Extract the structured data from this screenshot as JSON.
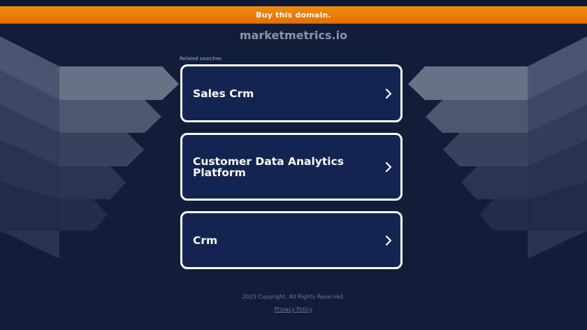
{
  "banner": {
    "text": "Buy this domain."
  },
  "domain": {
    "name": "marketmetrics.io"
  },
  "related": {
    "heading": "Related searches",
    "items": [
      {
        "label": "Sales Crm"
      },
      {
        "label": "Customer Data Analytics Platform"
      },
      {
        "label": "Crm"
      }
    ]
  },
  "footer": {
    "copyright": "2023 Copyright. All Rights Reserved.",
    "privacy": "Privacy Policy"
  },
  "colors": {
    "background": "#121d3a",
    "banner": "#f08a10",
    "card": "#12244f",
    "card_border": "#ffffff"
  },
  "icons": {
    "card_arrow": "chevron-right-icon"
  }
}
